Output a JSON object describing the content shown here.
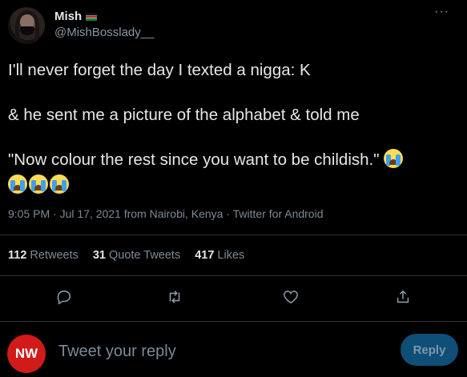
{
  "author": {
    "name": "Mish",
    "flag_icon": "kenya-flag-icon",
    "handle": "@MishBosslady__"
  },
  "more_icon": "more-horizontal-icon",
  "tweet": {
    "line1": "I'll never forget the day I texted a nigga: K",
    "line2": "& he sent me a picture of the alphabet & told me",
    "line3": "\"Now colour the rest since you want to be childish.\"",
    "emoji_name": "loudly-crying-face",
    "emoji_count": 4
  },
  "meta": "9:05 PM · Jul 17, 2021 from Nairobi, Kenya · Twitter for Android",
  "stats": {
    "retweets_count": "112",
    "retweets_label": "Retweets",
    "quotes_count": "31",
    "quotes_label": "Quote Tweets",
    "likes_count": "417",
    "likes_label": "Likes"
  },
  "actions": [
    "reply-icon",
    "retweet-icon",
    "like-icon",
    "share-icon"
  ],
  "reply_bar": {
    "avatar_text": "NW",
    "placeholder": "Tweet your reply",
    "button_label": "Reply"
  },
  "colors": {
    "background": "#000000",
    "muted": "#7d8a96",
    "avatar_red": "#d11a1a",
    "reply_button": "#0f4e77"
  }
}
